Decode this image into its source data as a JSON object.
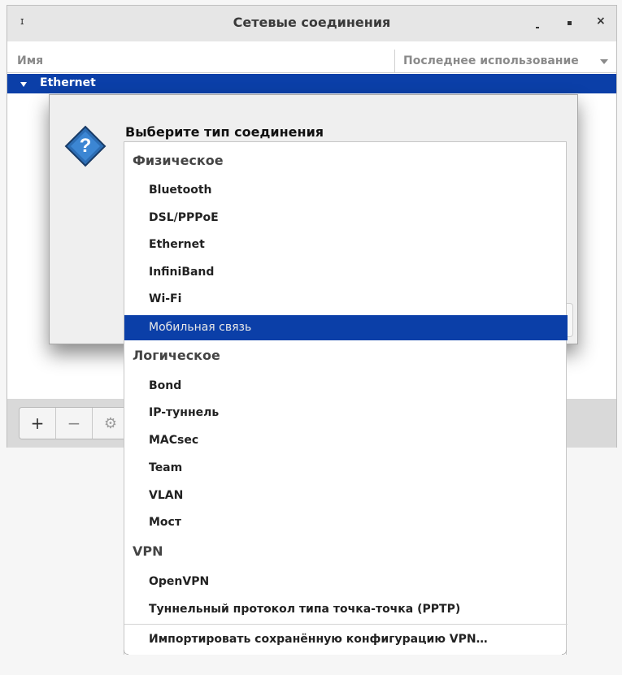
{
  "window": {
    "title": "Сетевые соединения",
    "title_icon": "network-icon",
    "controls": {
      "minimize": "minimize-icon",
      "maximize": "maximize-icon",
      "close": "close-icon"
    }
  },
  "list": {
    "col_name": "Имя",
    "col_last_used": "Последнее использование",
    "group_label": "Ethernet"
  },
  "toolbar": {
    "add_label": "+",
    "remove_label": "−",
    "settings_icon": "gear-icon"
  },
  "dialog": {
    "title": "Выберите тип соединения",
    "icon": "question-icon"
  },
  "menu": {
    "section_physical": "Физическое",
    "physical": [
      "Bluetooth",
      "DSL/PPPoE",
      "Ethernet",
      "InfiniBand",
      "Wi-Fi",
      "Мобильная связь"
    ],
    "section_logical": "Логическое",
    "logical": [
      "Bond",
      "IP-туннель",
      "MACsec",
      "Team",
      "VLAN",
      "Мост"
    ],
    "section_vpn": "VPN",
    "vpn": [
      "OpenVPN",
      "Туннельный протокол типа точка-точка (PPTP)"
    ],
    "import_vpn": "Импортировать сохранённую конфигурацию VPN…",
    "selected_item": "Мобильная связь"
  },
  "colors": {
    "selection": "#0b3fa8",
    "window_bg": "#d9d9d9",
    "menu_bg": "#ffffff"
  }
}
